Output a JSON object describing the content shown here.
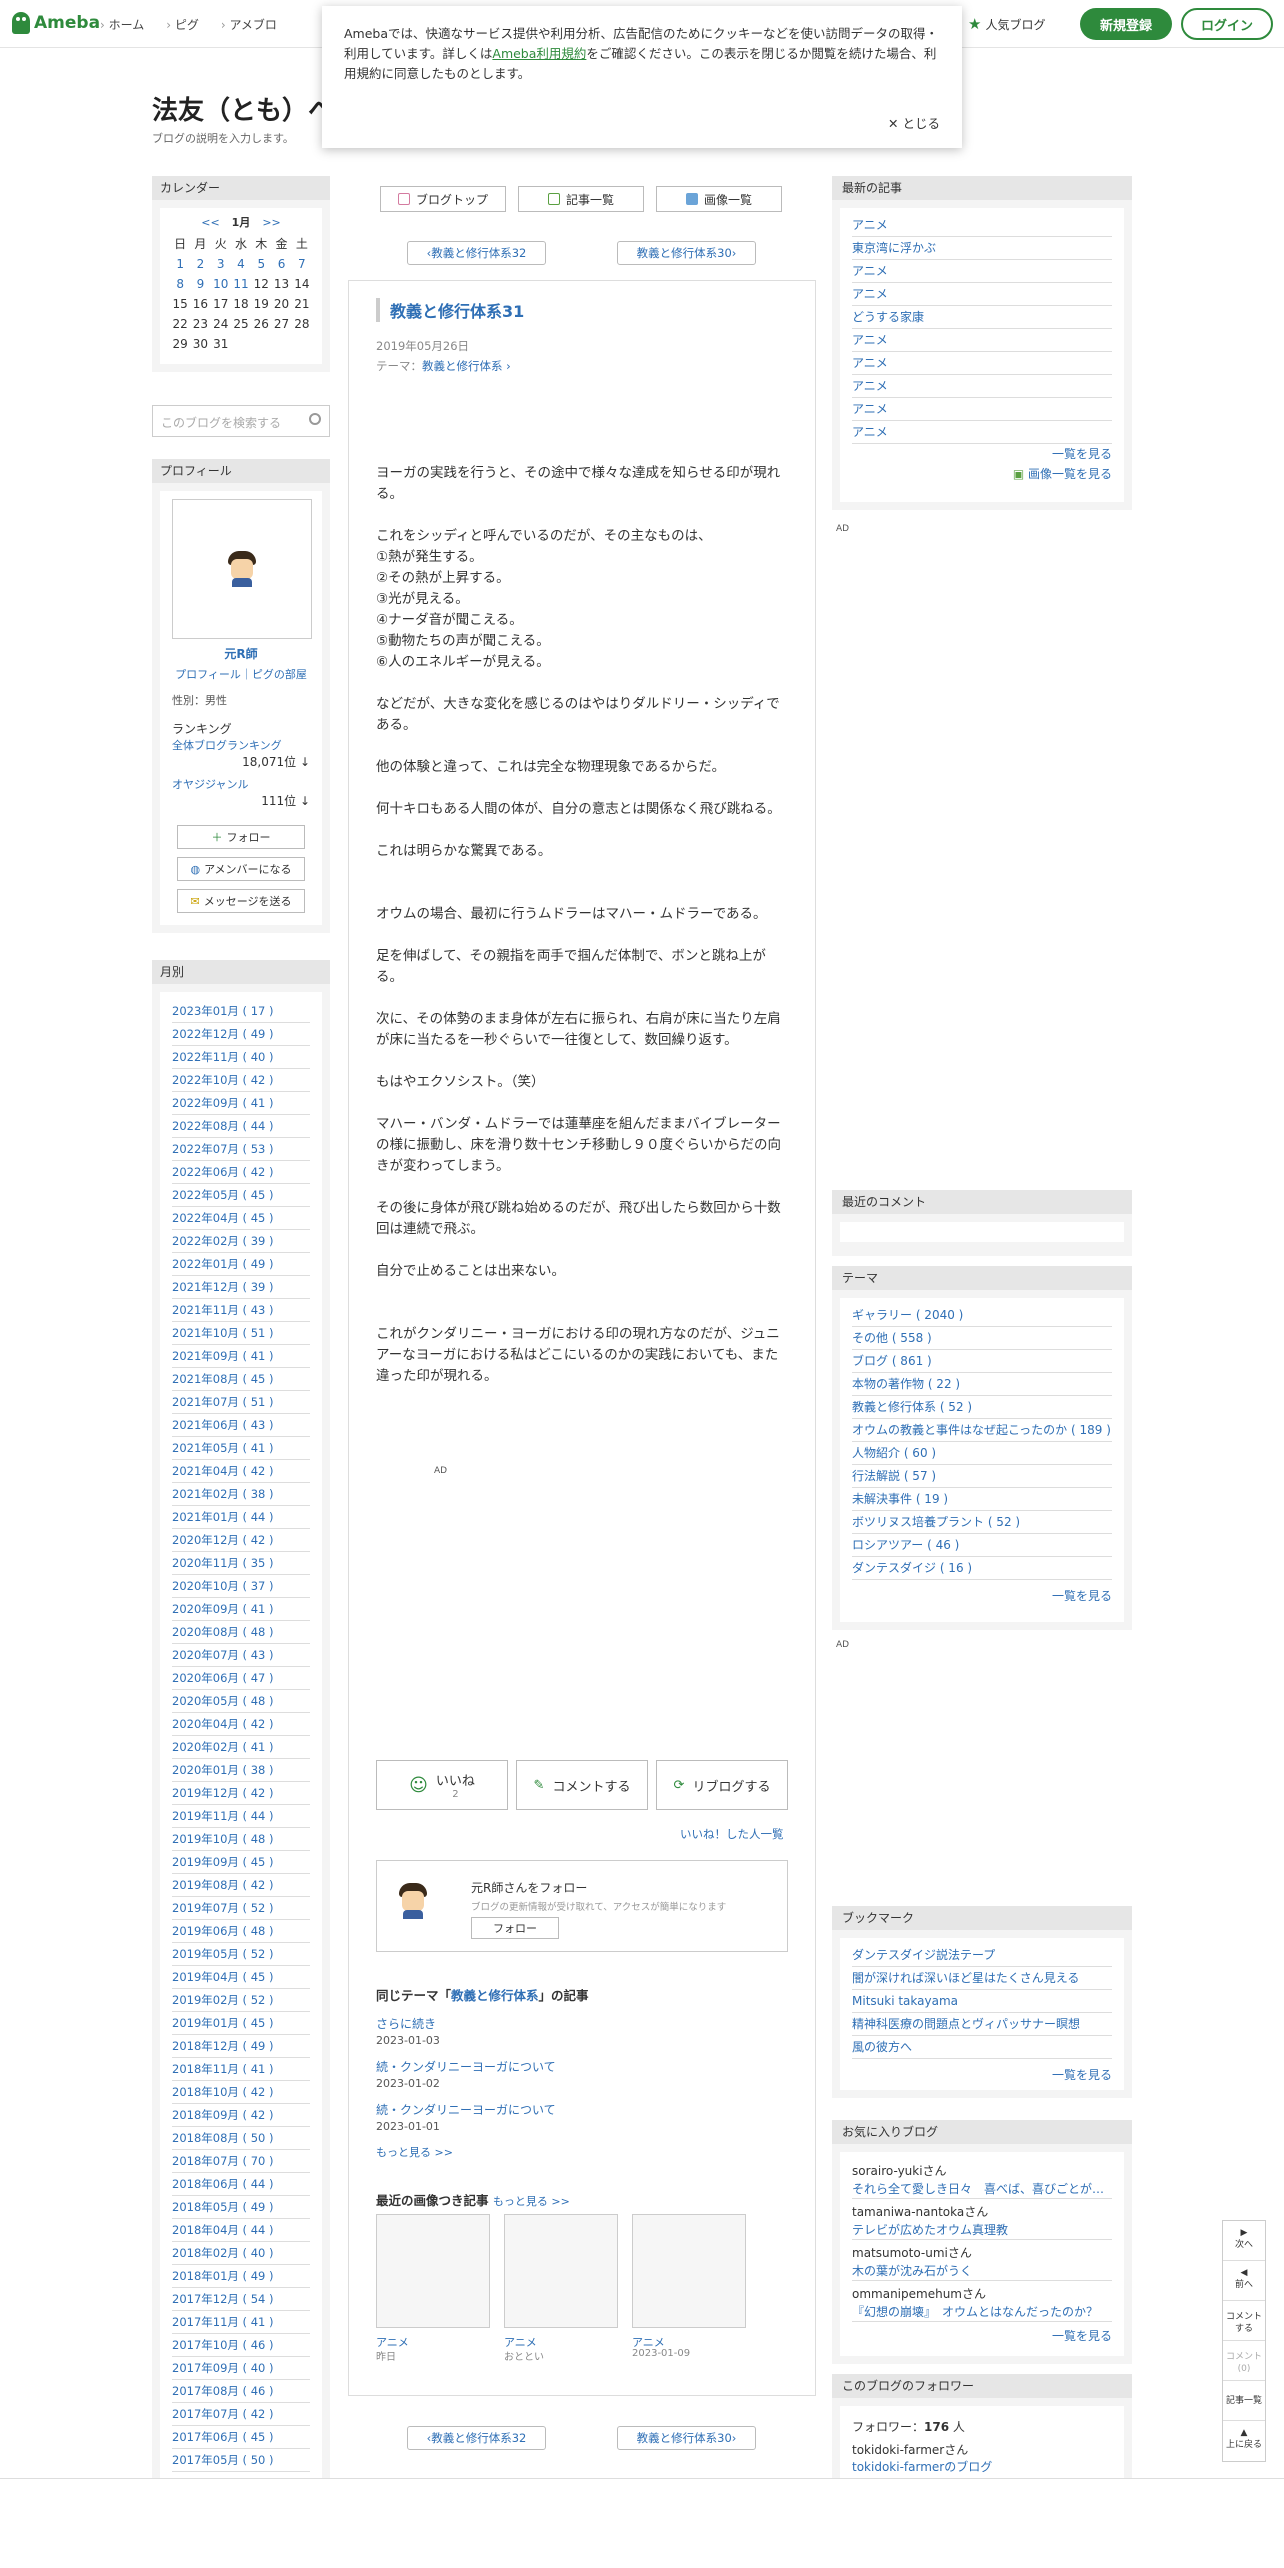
{
  "header": {
    "logo": "Ameba",
    "nav": [
      "ホーム",
      "ピグ",
      "アメブロ"
    ],
    "popular": "人気ブログ",
    "register": "新規登録",
    "login": "ログイン"
  },
  "cookie": {
    "text1": "Amebaでは、快適なサービス提供や利用分析、広告配信のためにクッキーなどを使い訪問データの取得・利用しています。詳しくは",
    "link": "Ameba利用規約",
    "text2": "をご確認ください。この表示を閉じるか閲覧を続けた場合、利用規約に同意したものとします。",
    "close": "とじる"
  },
  "blog": {
    "title": "法友（とも）へ",
    "desc": "ブログの説明を入力します。"
  },
  "calendar": {
    "title": "カレンダー",
    "prev": "<<",
    "month": "1月",
    "next": ">>",
    "weekdays": [
      "日",
      "月",
      "火",
      "水",
      "木",
      "金",
      "土"
    ],
    "cells": [
      "",
      "",
      "",
      "",
      "",
      "",
      "",
      "1",
      "2",
      "3",
      "4",
      "5",
      "6",
      "7",
      "8",
      "9",
      "10",
      "11",
      "12",
      "13",
      "14",
      "15",
      "16",
      "17",
      "18",
      "19",
      "20",
      "21",
      "22",
      "23",
      "24",
      "25",
      "26",
      "27",
      "28",
      "29",
      "30",
      "31"
    ],
    "linked": [
      "1",
      "2",
      "3",
      "4",
      "5",
      "6",
      "7",
      "8",
      "9",
      "10",
      "11"
    ]
  },
  "search": {
    "placeholder": "このブログを検索する"
  },
  "profile": {
    "title": "プロフィール",
    "name": "元R師",
    "links": "プロフィール｜ピグの部屋",
    "sex": "性別：男性",
    "ranking": "ランキング",
    "all": "全体ブログランキング",
    "all_val": "18,071位 ↓",
    "genre": "オヤジジャンル",
    "genre_val": "111位 ↓",
    "follow": "フォロー",
    "amember": "アメンバーになる",
    "message": "メッセージを送る"
  },
  "monthly": {
    "title": "月別",
    "items": [
      "2023年01月 ( 17 )",
      "2022年12月 ( 49 )",
      "2022年11月 ( 40 )",
      "2022年10月 ( 42 )",
      "2022年09月 ( 41 )",
      "2022年08月 ( 44 )",
      "2022年07月 ( 53 )",
      "2022年06月 ( 42 )",
      "2022年05月 ( 45 )",
      "2022年04月 ( 45 )",
      "2022年02月 ( 39 )",
      "2022年01月 ( 49 )",
      "2021年12月 ( 39 )",
      "2021年11月 ( 43 )",
      "2021年10月 ( 51 )",
      "2021年09月 ( 41 )",
      "2021年08月 ( 45 )",
      "2021年07月 ( 51 )",
      "2021年06月 ( 43 )",
      "2021年05月 ( 41 )",
      "2021年04月 ( 42 )",
      "2021年02月 ( 38 )",
      "2021年01月 ( 44 )",
      "2020年12月 ( 42 )",
      "2020年11月 ( 35 )",
      "2020年10月 ( 37 )",
      "2020年09月 ( 41 )",
      "2020年08月 ( 48 )",
      "2020年07月 ( 43 )",
      "2020年06月 ( 47 )",
      "2020年05月 ( 48 )",
      "2020年04月 ( 42 )",
      "2020年02月 ( 41 )",
      "2020年01月 ( 38 )",
      "2019年12月 ( 42 )",
      "2019年11月 ( 44 )",
      "2019年10月 ( 48 )",
      "2019年09月 ( 45 )",
      "2019年08月 ( 42 )",
      "2019年07月 ( 52 )",
      "2019年06月 ( 48 )",
      "2019年05月 ( 52 )",
      "2019年04月 ( 45 )",
      "2019年02月 ( 52 )",
      "2019年01月 ( 45 )",
      "2018年12月 ( 49 )",
      "2018年11月 ( 41 )",
      "2018年10月 ( 42 )",
      "2018年09月 ( 42 )",
      "2018年08月 ( 50 )",
      "2018年07月 ( 70 )",
      "2018年06月 ( 44 )",
      "2018年05月 ( 49 )",
      "2018年04月 ( 44 )",
      "2018年02月 ( 40 )",
      "2018年01月 ( 49 )",
      "2017年12月 ( 54 )",
      "2017年11月 ( 41 )",
      "2017年10月 ( 46 )",
      "2017年09月 ( 40 )",
      "2017年08月 ( 46 )",
      "2017年07月 ( 42 )",
      "2017年06月 ( 45 )",
      "2017年05月 ( 50 )"
    ]
  },
  "tabs": [
    "ブログトップ",
    "記事一覧",
    "画像一覧"
  ],
  "pager": {
    "prev": "教義と修行体系32",
    "next": "教義と修行体系30"
  },
  "article": {
    "title": "教義と修行体系31",
    "date": "2019年05月26日",
    "theme_label": "テーマ：",
    "theme": "教義と修行体系",
    "body": [
      "",
      "ヨーガの実践を行うと、その途中で様々な達成を知らせる印が現れる。",
      "",
      "これをシッディと呼んでいるのだが、その主なものは、",
      "①熱が発生する。",
      "②その熱が上昇する。",
      "③光が見える。",
      "④ナーダ音が聞こえる。",
      "⑤動物たちの声が聞こえる。",
      "⑥人のエネルギーが見える。",
      "",
      "などだが、大きな変化を感じるのはやはりダルドリー・シッディである。",
      "",
      "他の体験と違って、これは完全な物理現象であるからだ。",
      "",
      "何十キロもある人間の体が、自分の意志とは関係なく飛び跳ねる。",
      "",
      "これは明らかな驚異である。",
      "",
      "",
      "オウムの場合、最初に行うムドラーはマハー・ムドラーである。",
      "",
      "足を伸ばして、その親指を両手で掴んだ体制で、ボンと跳ね上がる。",
      "",
      "次に、その体勢のまま身体が左右に振られ、右肩が床に当たり左肩が床に当たるを一秒ぐらいで一往復として、数回繰り返す。",
      "",
      "もはやエクソシスト。（笑）",
      "",
      "マハー・バンダ・ムドラーでは蓮華座を組んだままバイブレーターの様に振動し、床を滑り数十センチ移動し９０度ぐらいからだの向きが変わってしまう。",
      "",
      "その後に身体が飛び跳ね始めるのだが、飛び出したら数回から十数回は連続で飛ぶ。",
      "",
      "自分で止めることは出来ない。",
      "",
      "",
      "これがクンダリニー・ヨーガにおける印の現れ方なのだが、ジュニアーなヨーガにおける私はどこにいるのかの実践においても、また違った印が現れる。"
    ]
  },
  "ad": "AD",
  "actions": {
    "like": "いいね",
    "like_count": "2",
    "comment": "コメントする",
    "reblog": "リブログする",
    "liked_users": "いいね！した人一覧"
  },
  "followbox": {
    "title": "元R師さんをフォロー",
    "desc": "ブログの更新情報が受け取れて、アクセスが簡単になります",
    "button": "フォロー"
  },
  "same_theme": {
    "prefix": "同じテーマ「",
    "theme": "教義と修行体系",
    "suffix": "」の記事",
    "items": [
      {
        "title": "さらに続き",
        "date": "2023-01-03"
      },
      {
        "title": "続・クンダリニーヨーガについて",
        "date": "2023-01-02"
      },
      {
        "title": "続・クンダリニーヨーガについて",
        "date": "2023-01-01"
      }
    ],
    "more": "もっと見る >>"
  },
  "recent_images": {
    "title": "最近の画像つき記事",
    "more": "もっと見る >>",
    "items": [
      {
        "label": "アニメ",
        "date": "昨日"
      },
      {
        "label": "アニメ",
        "date": "おととい"
      },
      {
        "label": "アニメ",
        "date": "2023-01-09"
      }
    ]
  },
  "latest": {
    "title": "最新の記事",
    "items": [
      "アニメ",
      "東京湾に浮かぶ",
      "アニメ",
      "アニメ",
      "どうする家康",
      "アニメ",
      "アニメ",
      "アニメ",
      "アニメ",
      "アニメ"
    ],
    "more": "一覧を見る",
    "images": "画像一覧を見る"
  },
  "recent_comments": {
    "title": "最近のコメント"
  },
  "themes": {
    "title": "テーマ",
    "items": [
      "ギャラリー ( 2040 )",
      "その他 ( 558 )",
      "ブログ ( 861 )",
      "本物の著作物 ( 22 )",
      "教義と修行体系 ( 52 )",
      "オウムの教義と事件はなぜ起こったのか ( 189 )",
      "人物紹介 ( 60 )",
      "行法解説 ( 57 )",
      "未解決事件 ( 19 )",
      "ボツリヌス培養プラント ( 52 )",
      "ロシアツアー ( 46 )",
      "ダンテスダイジ ( 16 )"
    ],
    "more": "一覧を見る"
  },
  "bookmarks": {
    "title": "ブックマーク",
    "items": [
      "ダンテスダイジ説法テープ",
      "闇が深ければ深いほど星はたくさん見える",
      "Mitsuki takayama",
      "精神科医療の問題点とヴィパッサナー瞑想",
      "風の彼方へ"
    ],
    "more": "一覧を見る"
  },
  "fav": {
    "title": "お気に入りブログ",
    "items": [
      {
        "user": "sorairo-yukiさん",
        "title": "それら全て愛しき日々　喜べば、喜びごとが…"
      },
      {
        "user": "tamaniwa-nantokaさん",
        "title": "テレビが広めたオウム真理教"
      },
      {
        "user": "matsumoto-umiさん",
        "title": "木の葉が沈み石がうく"
      },
      {
        "user": "ommanipemehumさん",
        "title": "『幻想の崩壊』　オウムとはなんだったのか？"
      }
    ],
    "more": "一覧を見る"
  },
  "followers": {
    "title": "このブログのフォロワー",
    "label": "フォロワー：",
    "count": "176",
    "unit": "人",
    "user": "tokidoki-farmerさん",
    "blog": "tokidoki-farmerのブログ"
  },
  "floatnav": {
    "next": "次へ",
    "prev": "前へ",
    "comment": "コメントする",
    "comments": "コメント(0)",
    "list": "記事一覧",
    "top": "上に戻る"
  }
}
